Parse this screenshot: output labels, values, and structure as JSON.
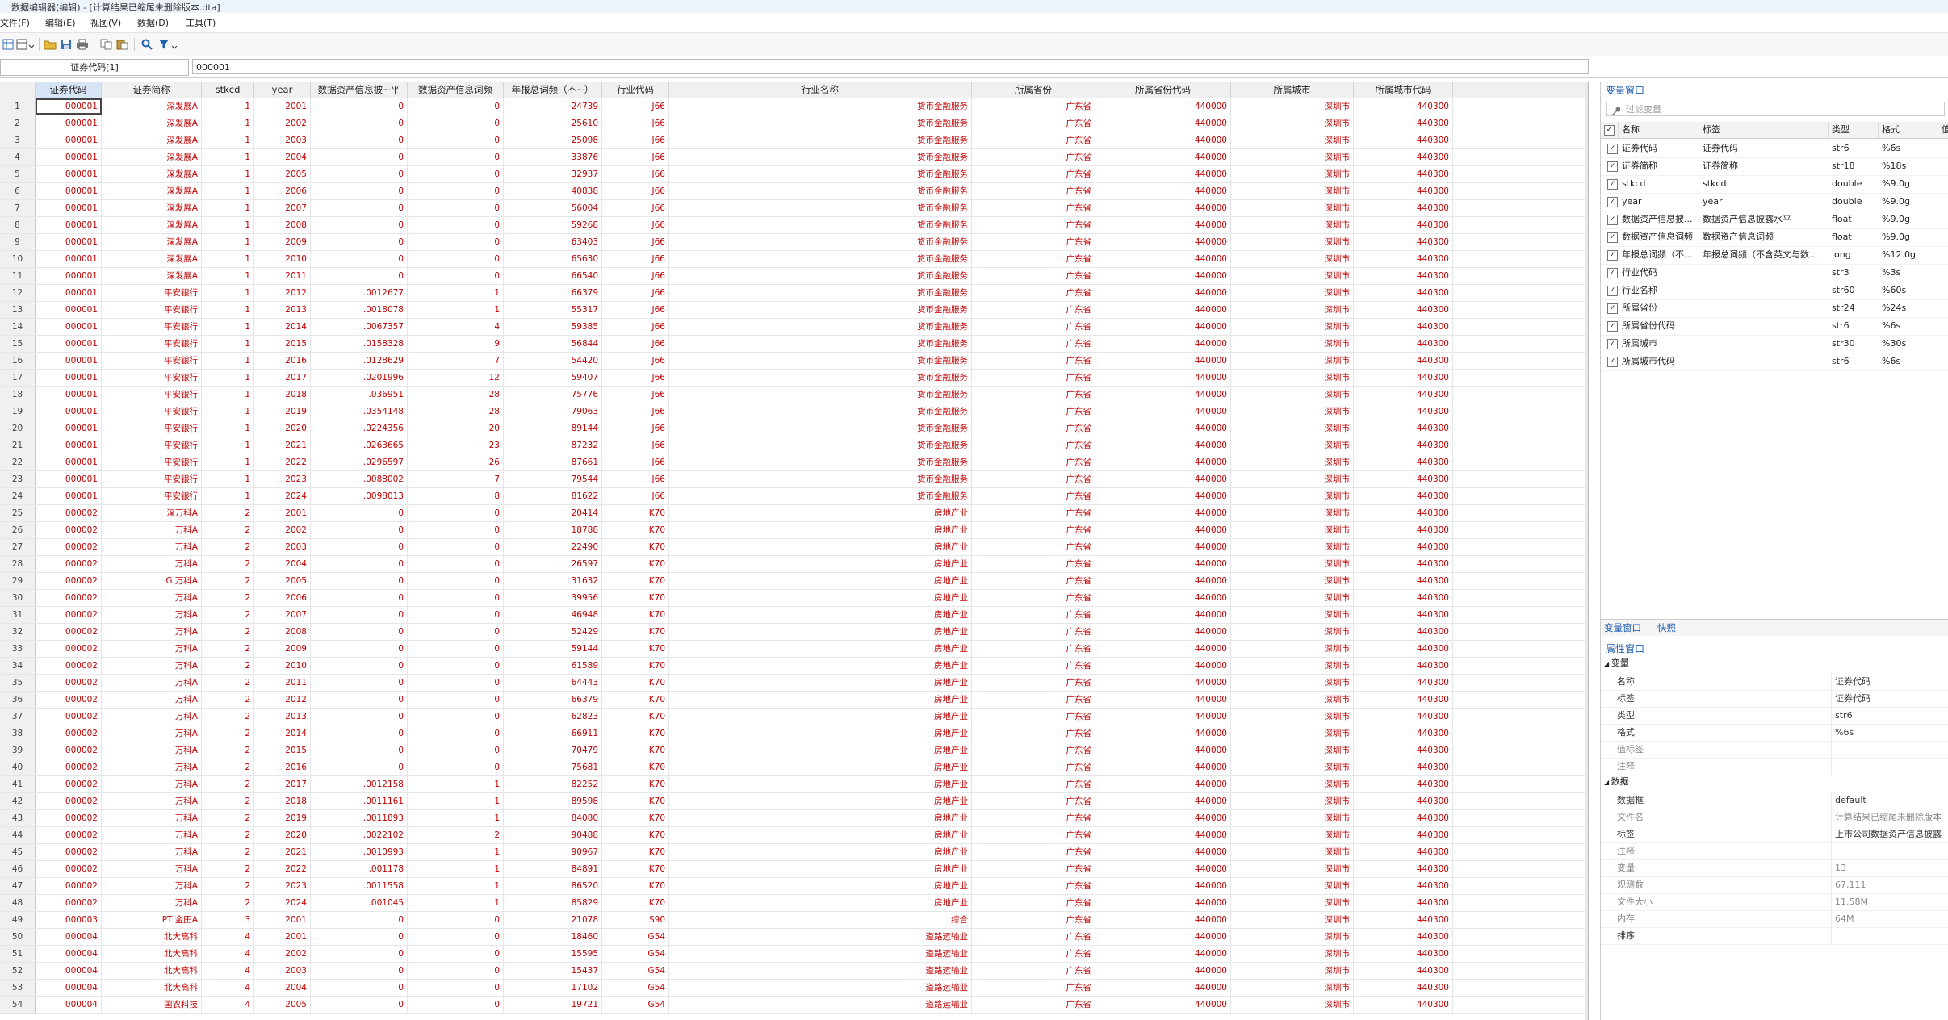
{
  "window": {
    "title": "数据编辑器(编辑) - [计算结果已缩尾未删除版本.dta]"
  },
  "menu": [
    {
      "label": "文件(F)"
    },
    {
      "label": "编辑(E)"
    },
    {
      "label": "视图(V)"
    },
    {
      "label": "数据(D)"
    },
    {
      "label": "工具(T)"
    }
  ],
  "toolbar": {
    "icons": [
      "data-editor-icon",
      "browse-mode-icon",
      "open-folder-icon",
      "save-icon",
      "print-icon",
      "copy-icon",
      "paste-icon",
      "search-icon",
      "filter-icon"
    ]
  },
  "editbar": {
    "cell_ref": "证券代码[1]",
    "cell_value": "000001"
  },
  "grid": {
    "columns": [
      {
        "label": "证券代码"
      },
      {
        "label": "证券简称"
      },
      {
        "label": "stkcd"
      },
      {
        "label": "year"
      },
      {
        "label": "数据资产信息披~平"
      },
      {
        "label": "数据资产信息词频"
      },
      {
        "label": "年报总词频（不~）"
      },
      {
        "label": "行业代码"
      },
      {
        "label": "行业名称"
      },
      {
        "label": "所属省份"
      },
      {
        "label": "所属省份代码"
      },
      {
        "label": "所属城市"
      },
      {
        "label": "所属城市代码"
      }
    ],
    "rows": [
      [
        "000001",
        "深发展A",
        "1",
        "2001",
        "0",
        "0",
        "24739",
        "J66",
        "货币金融服务",
        "广东省",
        "440000",
        "深圳市",
        "440300"
      ],
      [
        "000001",
        "深发展A",
        "1",
        "2002",
        "0",
        "0",
        "25610",
        "J66",
        "货币金融服务",
        "广东省",
        "440000",
        "深圳市",
        "440300"
      ],
      [
        "000001",
        "深发展A",
        "1",
        "2003",
        "0",
        "0",
        "25098",
        "J66",
        "货币金融服务",
        "广东省",
        "440000",
        "深圳市",
        "440300"
      ],
      [
        "000001",
        "深发展A",
        "1",
        "2004",
        "0",
        "0",
        "33876",
        "J66",
        "货币金融服务",
        "广东省",
        "440000",
        "深圳市",
        "440300"
      ],
      [
        "000001",
        "深发展A",
        "1",
        "2005",
        "0",
        "0",
        "32937",
        "J66",
        "货币金融服务",
        "广东省",
        "440000",
        "深圳市",
        "440300"
      ],
      [
        "000001",
        "深发展A",
        "1",
        "2006",
        "0",
        "0",
        "40838",
        "J66",
        "货币金融服务",
        "广东省",
        "440000",
        "深圳市",
        "440300"
      ],
      [
        "000001",
        "深发展A",
        "1",
        "2007",
        "0",
        "0",
        "56004",
        "J66",
        "货币金融服务",
        "广东省",
        "440000",
        "深圳市",
        "440300"
      ],
      [
        "000001",
        "深发展A",
        "1",
        "2008",
        "0",
        "0",
        "59268",
        "J66",
        "货币金融服务",
        "广东省",
        "440000",
        "深圳市",
        "440300"
      ],
      [
        "000001",
        "深发展A",
        "1",
        "2009",
        "0",
        "0",
        "63403",
        "J66",
        "货币金融服务",
        "广东省",
        "440000",
        "深圳市",
        "440300"
      ],
      [
        "000001",
        "深发展A",
        "1",
        "2010",
        "0",
        "0",
        "65630",
        "J66",
        "货币金融服务",
        "广东省",
        "440000",
        "深圳市",
        "440300"
      ],
      [
        "000001",
        "深发展A",
        "1",
        "2011",
        "0",
        "0",
        "66540",
        "J66",
        "货币金融服务",
        "广东省",
        "440000",
        "深圳市",
        "440300"
      ],
      [
        "000001",
        "平安银行",
        "1",
        "2012",
        ".0012677",
        "1",
        "66379",
        "J66",
        "货币金融服务",
        "广东省",
        "440000",
        "深圳市",
        "440300"
      ],
      [
        "000001",
        "平安银行",
        "1",
        "2013",
        ".0018078",
        "1",
        "55317",
        "J66",
        "货币金融服务",
        "广东省",
        "440000",
        "深圳市",
        "440300"
      ],
      [
        "000001",
        "平安银行",
        "1",
        "2014",
        ".0067357",
        "4",
        "59385",
        "J66",
        "货币金融服务",
        "广东省",
        "440000",
        "深圳市",
        "440300"
      ],
      [
        "000001",
        "平安银行",
        "1",
        "2015",
        ".0158328",
        "9",
        "56844",
        "J66",
        "货币金融服务",
        "广东省",
        "440000",
        "深圳市",
        "440300"
      ],
      [
        "000001",
        "平安银行",
        "1",
        "2016",
        ".0128629",
        "7",
        "54420",
        "J66",
        "货币金融服务",
        "广东省",
        "440000",
        "深圳市",
        "440300"
      ],
      [
        "000001",
        "平安银行",
        "1",
        "2017",
        ".0201996",
        "12",
        "59407",
        "J66",
        "货币金融服务",
        "广东省",
        "440000",
        "深圳市",
        "440300"
      ],
      [
        "000001",
        "平安银行",
        "1",
        "2018",
        ".036951",
        "28",
        "75776",
        "J66",
        "货币金融服务",
        "广东省",
        "440000",
        "深圳市",
        "440300"
      ],
      [
        "000001",
        "平安银行",
        "1",
        "2019",
        ".0354148",
        "28",
        "79063",
        "J66",
        "货币金融服务",
        "广东省",
        "440000",
        "深圳市",
        "440300"
      ],
      [
        "000001",
        "平安银行",
        "1",
        "2020",
        ".0224356",
        "20",
        "89144",
        "J66",
        "货币金融服务",
        "广东省",
        "440000",
        "深圳市",
        "440300"
      ],
      [
        "000001",
        "平安银行",
        "1",
        "2021",
        ".0263665",
        "23",
        "87232",
        "J66",
        "货币金融服务",
        "广东省",
        "440000",
        "深圳市",
        "440300"
      ],
      [
        "000001",
        "平安银行",
        "1",
        "2022",
        ".0296597",
        "26",
        "87661",
        "J66",
        "货币金融服务",
        "广东省",
        "440000",
        "深圳市",
        "440300"
      ],
      [
        "000001",
        "平安银行",
        "1",
        "2023",
        ".0088002",
        "7",
        "79544",
        "J66",
        "货币金融服务",
        "广东省",
        "440000",
        "深圳市",
        "440300"
      ],
      [
        "000001",
        "平安银行",
        "1",
        "2024",
        ".0098013",
        "8",
        "81622",
        "J66",
        "货币金融服务",
        "广东省",
        "440000",
        "深圳市",
        "440300"
      ],
      [
        "000002",
        "深万科A",
        "2",
        "2001",
        "0",
        "0",
        "20414",
        "K70",
        "房地产业",
        "广东省",
        "440000",
        "深圳市",
        "440300"
      ],
      [
        "000002",
        "万科A",
        "2",
        "2002",
        "0",
        "0",
        "18788",
        "K70",
        "房地产业",
        "广东省",
        "440000",
        "深圳市",
        "440300"
      ],
      [
        "000002",
        "万科A",
        "2",
        "2003",
        "0",
        "0",
        "22490",
        "K70",
        "房地产业",
        "广东省",
        "440000",
        "深圳市",
        "440300"
      ],
      [
        "000002",
        "万科A",
        "2",
        "2004",
        "0",
        "0",
        "26597",
        "K70",
        "房地产业",
        "广东省",
        "440000",
        "深圳市",
        "440300"
      ],
      [
        "000002",
        "G 万科A",
        "2",
        "2005",
        "0",
        "0",
        "31632",
        "K70",
        "房地产业",
        "广东省",
        "440000",
        "深圳市",
        "440300"
      ],
      [
        "000002",
        "万科A",
        "2",
        "2006",
        "0",
        "0",
        "39956",
        "K70",
        "房地产业",
        "广东省",
        "440000",
        "深圳市",
        "440300"
      ],
      [
        "000002",
        "万科A",
        "2",
        "2007",
        "0",
        "0",
        "46948",
        "K70",
        "房地产业",
        "广东省",
        "440000",
        "深圳市",
        "440300"
      ],
      [
        "000002",
        "万科A",
        "2",
        "2008",
        "0",
        "0",
        "52429",
        "K70",
        "房地产业",
        "广东省",
        "440000",
        "深圳市",
        "440300"
      ],
      [
        "000002",
        "万科A",
        "2",
        "2009",
        "0",
        "0",
        "59144",
        "K70",
        "房地产业",
        "广东省",
        "440000",
        "深圳市",
        "440300"
      ],
      [
        "000002",
        "万科A",
        "2",
        "2010",
        "0",
        "0",
        "61589",
        "K70",
        "房地产业",
        "广东省",
        "440000",
        "深圳市",
        "440300"
      ],
      [
        "000002",
        "万科A",
        "2",
        "2011",
        "0",
        "0",
        "64443",
        "K70",
        "房地产业",
        "广东省",
        "440000",
        "深圳市",
        "440300"
      ],
      [
        "000002",
        "万科A",
        "2",
        "2012",
        "0",
        "0",
        "66379",
        "K70",
        "房地产业",
        "广东省",
        "440000",
        "深圳市",
        "440300"
      ],
      [
        "000002",
        "万科A",
        "2",
        "2013",
        "0",
        "0",
        "62823",
        "K70",
        "房地产业",
        "广东省",
        "440000",
        "深圳市",
        "440300"
      ],
      [
        "000002",
        "万科A",
        "2",
        "2014",
        "0",
        "0",
        "66911",
        "K70",
        "房地产业",
        "广东省",
        "440000",
        "深圳市",
        "440300"
      ],
      [
        "000002",
        "万科A",
        "2",
        "2015",
        "0",
        "0",
        "70479",
        "K70",
        "房地产业",
        "广东省",
        "440000",
        "深圳市",
        "440300"
      ],
      [
        "000002",
        "万科A",
        "2",
        "2016",
        "0",
        "0",
        "75681",
        "K70",
        "房地产业",
        "广东省",
        "440000",
        "深圳市",
        "440300"
      ],
      [
        "000002",
        "万科A",
        "2",
        "2017",
        ".0012158",
        "1",
        "82252",
        "K70",
        "房地产业",
        "广东省",
        "440000",
        "深圳市",
        "440300"
      ],
      [
        "000002",
        "万科A",
        "2",
        "2018",
        ".0011161",
        "1",
        "89598",
        "K70",
        "房地产业",
        "广东省",
        "440000",
        "深圳市",
        "440300"
      ],
      [
        "000002",
        "万科A",
        "2",
        "2019",
        ".0011893",
        "1",
        "84080",
        "K70",
        "房地产业",
        "广东省",
        "440000",
        "深圳市",
        "440300"
      ],
      [
        "000002",
        "万科A",
        "2",
        "2020",
        ".0022102",
        "2",
        "90488",
        "K70",
        "房地产业",
        "广东省",
        "440000",
        "深圳市",
        "440300"
      ],
      [
        "000002",
        "万科A",
        "2",
        "2021",
        ".0010993",
        "1",
        "90967",
        "K70",
        "房地产业",
        "广东省",
        "440000",
        "深圳市",
        "440300"
      ],
      [
        "000002",
        "万科A",
        "2",
        "2022",
        ".001178",
        "1",
        "84891",
        "K70",
        "房地产业",
        "广东省",
        "440000",
        "深圳市",
        "440300"
      ],
      [
        "000002",
        "万科A",
        "2",
        "2023",
        ".0011558",
        "1",
        "86520",
        "K70",
        "房地产业",
        "广东省",
        "440000",
        "深圳市",
        "440300"
      ],
      [
        "000002",
        "万科A",
        "2",
        "2024",
        ".001045",
        "1",
        "85829",
        "K70",
        "房地产业",
        "广东省",
        "440000",
        "深圳市",
        "440300"
      ],
      [
        "000003",
        "PT 金田A",
        "3",
        "2001",
        "0",
        "0",
        "21078",
        "S90",
        "综合",
        "广东省",
        "440000",
        "深圳市",
        "440300"
      ],
      [
        "000004",
        "北大高科",
        "4",
        "2001",
        "0",
        "0",
        "18460",
        "G54",
        "道路运输业",
        "广东省",
        "440000",
        "深圳市",
        "440300"
      ],
      [
        "000004",
        "北大高科",
        "4",
        "2002",
        "0",
        "0",
        "15595",
        "G54",
        "道路运输业",
        "广东省",
        "440000",
        "深圳市",
        "440300"
      ],
      [
        "000004",
        "北大高科",
        "4",
        "2003",
        "0",
        "0",
        "15437",
        "G54",
        "道路运输业",
        "广东省",
        "440000",
        "深圳市",
        "440300"
      ],
      [
        "000004",
        "北大高科",
        "4",
        "2004",
        "0",
        "0",
        "17102",
        "G54",
        "道路运输业",
        "广东省",
        "440000",
        "深圳市",
        "440300"
      ],
      [
        "000004",
        "国农科技",
        "4",
        "2005",
        "0",
        "0",
        "19721",
        "G54",
        "道路运输业",
        "广东省",
        "440000",
        "深圳市",
        "440300"
      ]
    ]
  },
  "variables_panel": {
    "title": "变量窗口",
    "filter_placeholder": "过滤变量",
    "headers": {
      "name": "名称",
      "label": "标签",
      "type": "类型",
      "format": "格式",
      "value": "值"
    },
    "items": [
      {
        "name": "证券代码",
        "label": "证券代码",
        "type": "str6",
        "format": "%6s"
      },
      {
        "name": "证券简称",
        "label": "证券简称",
        "type": "str18",
        "format": "%18s"
      },
      {
        "name": "stkcd",
        "label": "stkcd",
        "type": "double",
        "format": "%9.0g"
      },
      {
        "name": "year",
        "label": "year",
        "type": "double",
        "format": "%9.0g"
      },
      {
        "name": "数据资产信息披...",
        "label": "数据资产信息披露水平",
        "type": "float",
        "format": "%9.0g"
      },
      {
        "name": "数据资产信息词频",
        "label": "数据资产信息词频",
        "type": "float",
        "format": "%9.0g"
      },
      {
        "name": "年报总词频（不...",
        "label": "年报总词频（不含英文与数...",
        "type": "long",
        "format": "%12.0g"
      },
      {
        "name": "行业代码",
        "label": "",
        "type": "str3",
        "format": "%3s"
      },
      {
        "name": "行业名称",
        "label": "",
        "type": "str60",
        "format": "%60s"
      },
      {
        "name": "所属省份",
        "label": "",
        "type": "str24",
        "format": "%24s"
      },
      {
        "name": "所属省份代码",
        "label": "",
        "type": "str6",
        "format": "%6s"
      },
      {
        "name": "所属城市",
        "label": "",
        "type": "str30",
        "format": "%30s"
      },
      {
        "name": "所属城市代码",
        "label": "",
        "type": "str6",
        "format": "%6s"
      }
    ],
    "tabs": [
      {
        "label": "变量窗口"
      },
      {
        "label": "快照"
      }
    ]
  },
  "properties_panel": {
    "title": "属性窗口",
    "sections": [
      {
        "title": "变量",
        "rows": [
          {
            "key": "名称",
            "value": "证券代码",
            "dim": false
          },
          {
            "key": "标签",
            "value": "证券代码",
            "dim": false
          },
          {
            "key": "类型",
            "value": "str6",
            "dim": false
          },
          {
            "key": "格式",
            "value": "%6s",
            "dim": false
          },
          {
            "key": "值标签",
            "value": "",
            "dim": true
          },
          {
            "key": "注释",
            "value": "",
            "dim": true
          }
        ]
      },
      {
        "title": "数据",
        "rows": [
          {
            "key": "数据框",
            "value": "default",
            "dim": false
          },
          {
            "key": "文件名",
            "value": "计算结果已缩尾未删除版本",
            "dim": true
          },
          {
            "key": "标签",
            "value": "上市公司数据资产信息披露",
            "dim": false
          },
          {
            "key": "注释",
            "value": "",
            "dim": true
          },
          {
            "key": "变量",
            "value": "13",
            "dim": true
          },
          {
            "key": "观测数",
            "value": "67,111",
            "dim": true
          },
          {
            "key": "文件大小",
            "value": "11.58M",
            "dim": true
          },
          {
            "key": "内存",
            "value": "64M",
            "dim": true
          },
          {
            "key": "排序",
            "value": "",
            "dim": false
          }
        ]
      }
    ]
  },
  "colors": {
    "data_text": "#c00000",
    "panel_title": "#1f5fb0",
    "header_bg": "#f0f0f0"
  }
}
